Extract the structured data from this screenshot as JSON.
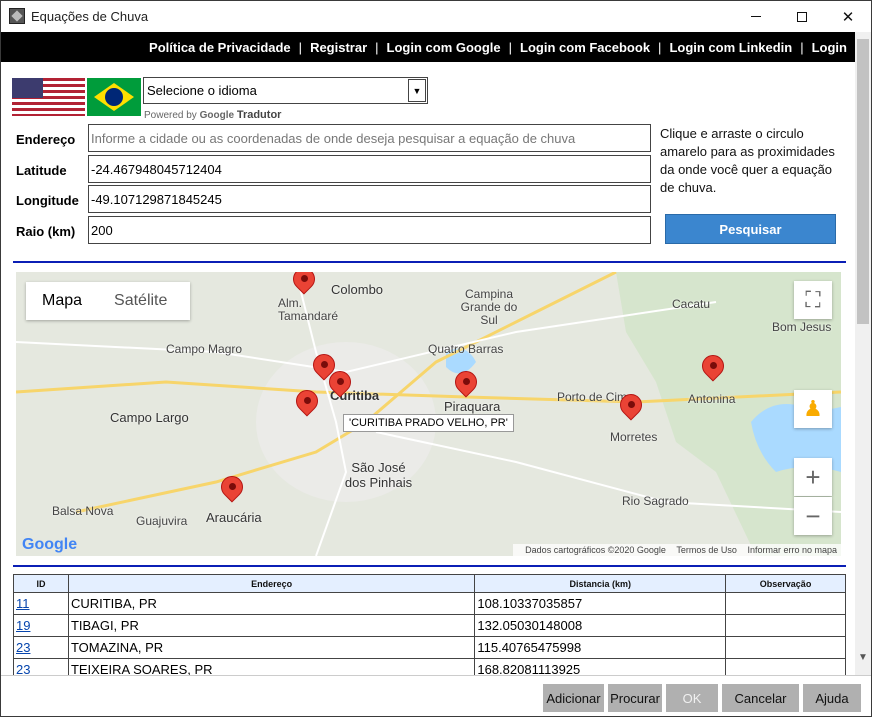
{
  "window": {
    "title": "Equações de Chuva"
  },
  "nav": {
    "links": [
      "Política de Privacidade",
      "Registrar",
      "Login com Google",
      "Login com Facebook",
      "Login com Linkedin",
      "Login"
    ]
  },
  "lang": {
    "select_value": "Selecione o idioma",
    "powered_by": "Powered by",
    "google": "Google",
    "tradutor": "Tradutor"
  },
  "form": {
    "endereco_label": "Endereço",
    "endereco_placeholder": "Informe a cidade ou as coordenadas de onde deseja pesquisar a equação de chuva",
    "latitude_label": "Latitude",
    "latitude_value": "-24.467948045712404",
    "longitude_label": "Longitude",
    "longitude_value": "-49.107129871845245",
    "raio_label": "Raio (km)",
    "raio_value": "200",
    "hint": "Clique e arraste o circulo amarelo para as proximidades da onde você quer a equação de chuva.",
    "search_button": "Pesquisar"
  },
  "map": {
    "tab_map": "Mapa",
    "tab_satellite": "Satélite",
    "tooltip": "'CURITIBA PRADO VELHO, PR'",
    "footer_data": "Dados cartográficos ©2020 Google",
    "footer_terms": "Termos de Uso",
    "footer_report": "Informar erro no mapa",
    "google_logo": "Google",
    "places": {
      "colombo": "Colombo",
      "tamandare": "Alm. Tamandaré",
      "campina": "Campina Grande do Sul",
      "campo_magro": "Campo Magro",
      "quatro_barras": "Quatro Barras",
      "campo_largo": "Campo Largo",
      "curitiba": "Curitiba",
      "piraquara": "Piraquara",
      "porto_cima": "Porto de Cima",
      "morretes": "Morretes",
      "antonina": "Antonina",
      "sao_jose": "São José dos Pinhais",
      "araucaria": "Araucária",
      "balsa_nova": "Balsa Nova",
      "guajuvira": "Guajuvira",
      "rio_sagrado": "Rio Sagrado",
      "cacatu": "Cacatu",
      "bom_jesus": "Bom Jesus"
    }
  },
  "table": {
    "headers": [
      "ID",
      "Endereço",
      "Distancia (km)",
      "Observação"
    ],
    "rows": [
      {
        "id": "11",
        "endereco": "CURITIBA, PR",
        "distancia": "108.10337035857",
        "obs": ""
      },
      {
        "id": "19",
        "endereco": "TIBAGI, PR",
        "distancia": "132.05030148008",
        "obs": ""
      },
      {
        "id": "23",
        "endereco": "TOMAZINA, PR",
        "distancia": "115.40765475998",
        "obs": ""
      },
      {
        "id": "23",
        "endereco": "TEIXEIRA SOARES, PR",
        "distancia": "168.82081113925",
        "obs": ""
      }
    ]
  },
  "buttons": {
    "adicionar": "Adicionar",
    "procurar": "Procurar",
    "ok": "OK",
    "cancelar": "Cancelar",
    "ajuda": "Ajuda"
  }
}
